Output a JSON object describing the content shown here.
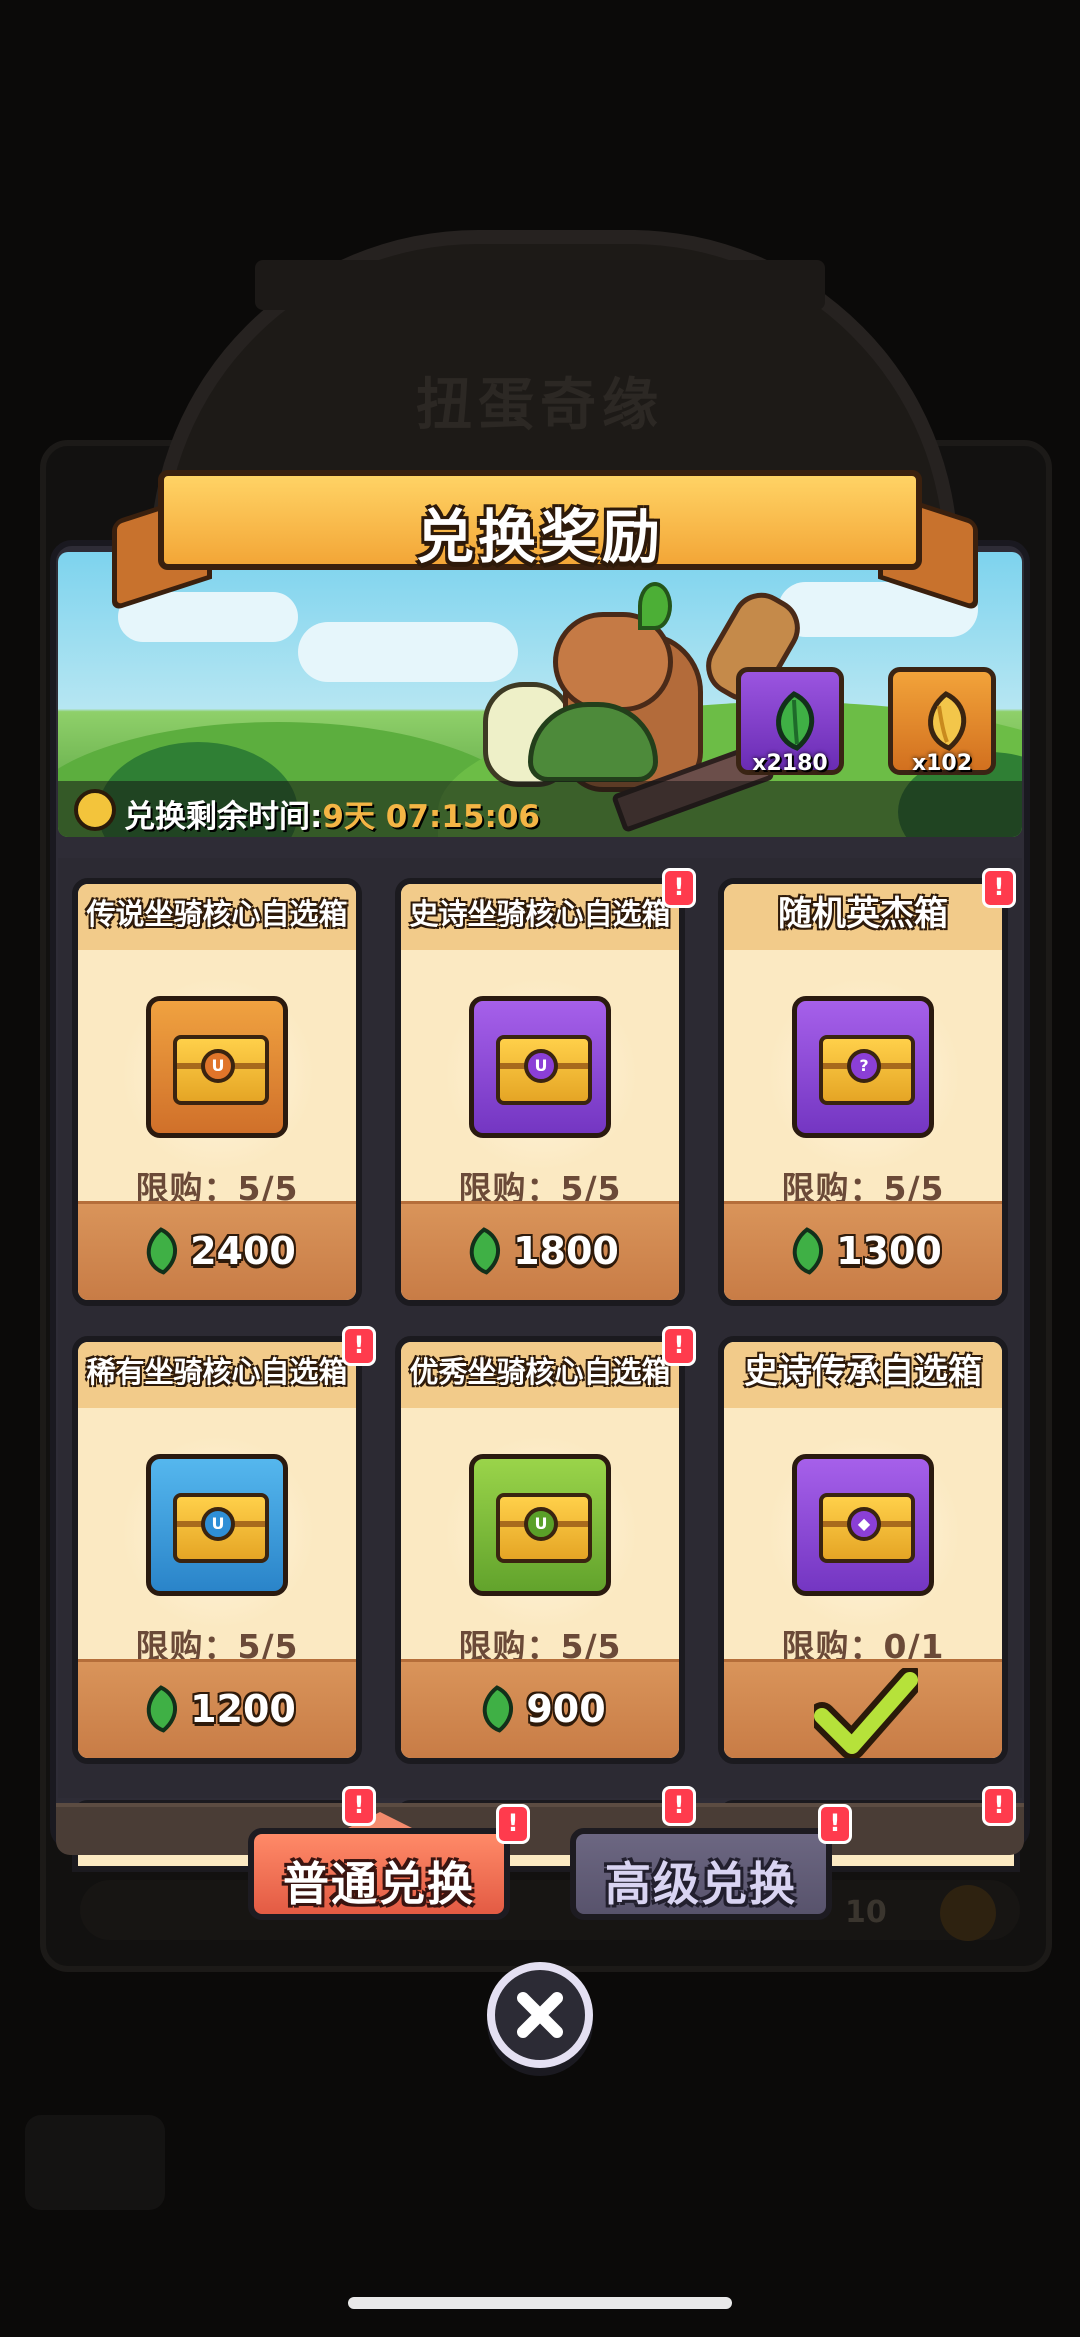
{
  "background": {
    "event_title": "扭蛋奇缘",
    "count_text": "10"
  },
  "dialog": {
    "title": "兑换奖励",
    "currencies": [
      {
        "icon": "green-leaf-icon",
        "count": "x2180"
      },
      {
        "icon": "golden-seed-icon",
        "count": "x102"
      }
    ],
    "timer": {
      "label": "兑换剩余时间:",
      "value": "9天 07:15:06"
    }
  },
  "shop_items": [
    {
      "name": "传说坐骑核心自选箱",
      "chest": "orange",
      "limit": "限购：5/5",
      "price": "2400",
      "badge": false
    },
    {
      "name": "史诗坐骑核心自选箱",
      "chest": "purple",
      "limit": "限购：5/5",
      "price": "1800",
      "badge": true
    },
    {
      "name": "随机英杰箱",
      "chest": "purple-question",
      "limit": "限购：5/5",
      "price": "1300",
      "badge": true
    },
    {
      "name": "稀有坐骑核心自选箱",
      "chest": "blue",
      "limit": "限购：5/5",
      "price": "1200",
      "badge": true
    },
    {
      "name": "优秀坐骑核心自选箱",
      "chest": "green",
      "limit": "限购：5/5",
      "price": "900",
      "badge": true
    },
    {
      "name": "史诗传承自选箱",
      "chest": "purple-lion",
      "limit": "限购：0/1",
      "price": null,
      "purchased": true,
      "badge": false
    }
  ],
  "tabs": {
    "normal": "普通兑换",
    "advanced": "高级兑换"
  },
  "badge_mark": "!",
  "colors": {
    "accent_orange": "#f3a637",
    "tab_active": "#e35b44",
    "tab_inactive": "#58536c",
    "badge_red": "#ff3b4d",
    "card_bg": "#fbe9c2",
    "price_bar": "#c87c46",
    "timer_value": "#f4b545"
  }
}
